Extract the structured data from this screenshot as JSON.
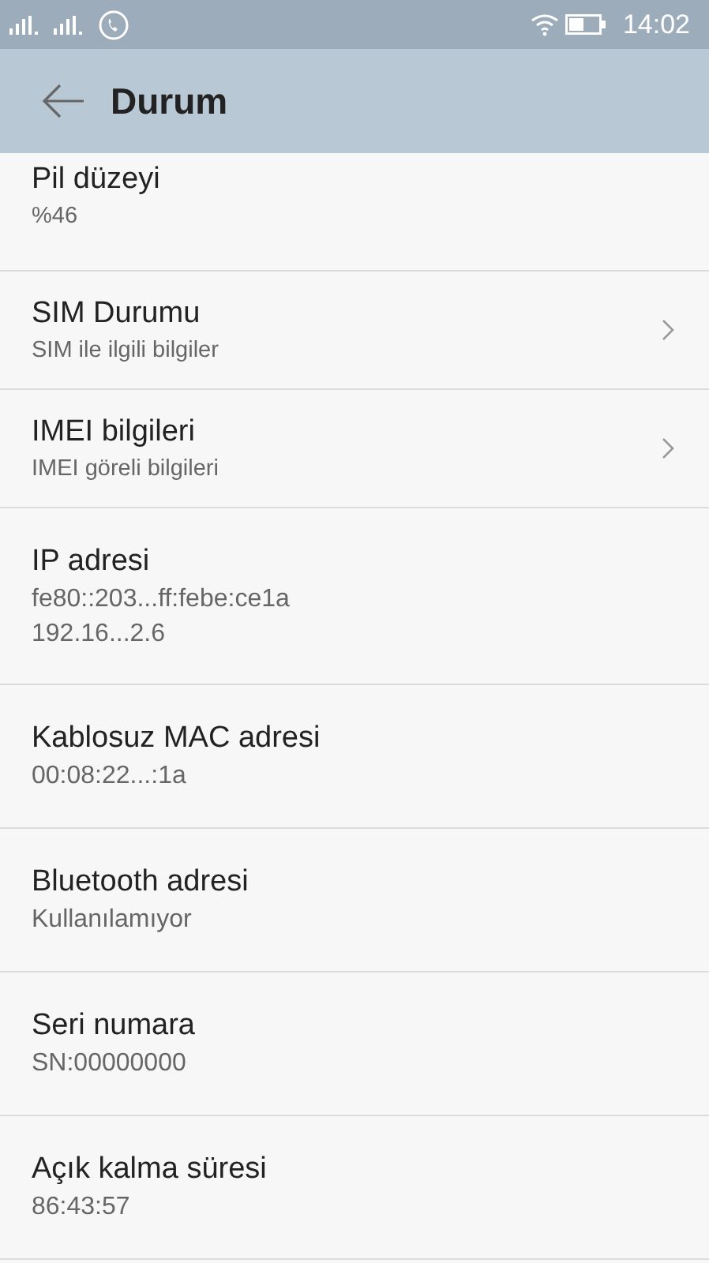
{
  "status_bar": {
    "time": "14:02"
  },
  "header": {
    "title": "Durum"
  },
  "items": [
    {
      "title": "Pil düzeyi",
      "lines": [
        "%46"
      ],
      "chevron": false
    },
    {
      "title": "SIM Durumu",
      "lines": [
        "SIM ile ilgili bilgiler"
      ],
      "chevron": true
    },
    {
      "title": "IMEI bilgileri",
      "lines": [
        "IMEI göreli bilgileri"
      ],
      "chevron": true
    },
    {
      "title": "IP adresi",
      "lines": [
        "fe80::203...ff:febe:ce1a",
        "192.16...2.6"
      ],
      "chevron": false
    },
    {
      "title": "Kablosuz MAC adresi",
      "lines": [
        "00:08:22...:1a"
      ],
      "chevron": false
    },
    {
      "title": "Bluetooth adresi",
      "lines": [
        "Kullanılamıyor"
      ],
      "chevron": false
    },
    {
      "title": "Seri numara",
      "lines": [
        "SN:00000000"
      ],
      "chevron": false
    },
    {
      "title": "Açık kalma süresi",
      "lines": [
        "86:43:57"
      ],
      "chevron": false
    }
  ]
}
